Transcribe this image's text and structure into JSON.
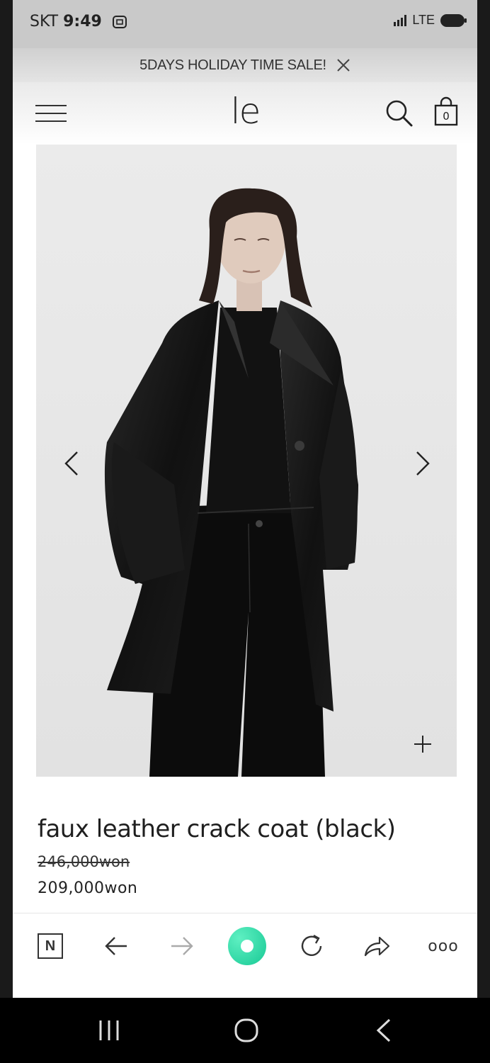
{
  "status_bar": {
    "carrier": "SKT",
    "time": "9:49",
    "network": "LTE"
  },
  "banner": {
    "text": "5DAYS HOLIDAY TIME SALE!"
  },
  "header": {
    "logo": "le",
    "cart_count": "0"
  },
  "product": {
    "title": "faux leather crack coat (black)",
    "original_price": "246,000won",
    "sale_price": "209,000won"
  },
  "browser_toolbar": {
    "home_label": "N",
    "more_label": "ooo"
  },
  "colors": {
    "accent_green": "#18c995",
    "status_bar_bg": "#c9c9c9"
  },
  "icons": [
    "menu-icon",
    "search-icon",
    "shopping-bag-icon",
    "close-icon",
    "chevron-left-icon",
    "chevron-right-icon",
    "plus-icon",
    "back-arrow-icon",
    "forward-arrow-icon",
    "refresh-icon",
    "share-icon",
    "more-icon"
  ]
}
